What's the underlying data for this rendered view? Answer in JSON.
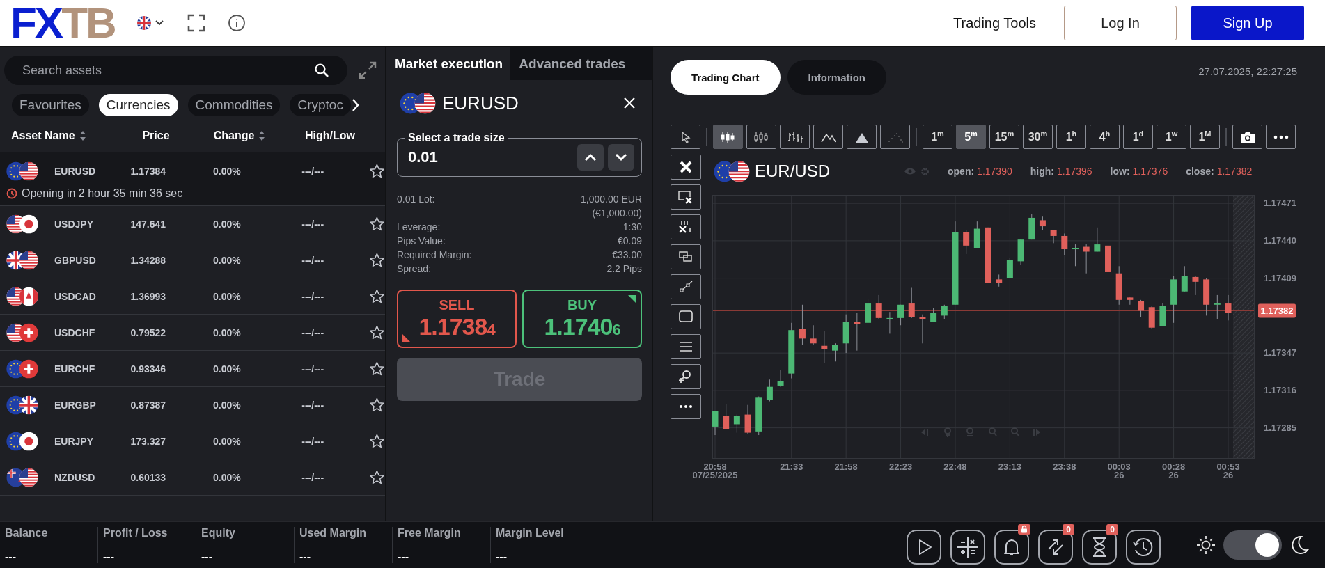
{
  "header": {
    "logo": {
      "primary": "FX",
      "secondary": "TB"
    },
    "nav_link": "Trading Tools",
    "login_button": "Log In",
    "signup_button": "Sign Up"
  },
  "asset_panel": {
    "search": {
      "placeholder": "Search assets"
    },
    "categories": [
      {
        "label": "Favourites",
        "selected": false
      },
      {
        "label": "Currencies",
        "selected": true
      },
      {
        "label": "Commodities",
        "selected": false
      },
      {
        "label": "Cryptoc",
        "selected": false
      }
    ],
    "columns": [
      {
        "label": "Asset Name",
        "sortable": true
      },
      {
        "label": "Price",
        "sortable": false
      },
      {
        "label": "Change",
        "sortable": true
      },
      {
        "label": "High/Low",
        "sortable": false
      }
    ],
    "rows": [
      {
        "symbol": "EURUSD",
        "price": "1.17384",
        "change": "0.00%",
        "high_low": "---/---",
        "favourite": false,
        "selected": true,
        "notice": "Opening in 2 hour 35 min 36 sec"
      },
      {
        "symbol": "USDJPY",
        "price": "147.641",
        "change": "0.00%",
        "high_low": "---/---",
        "favourite": false,
        "selected": false
      },
      {
        "symbol": "GBPUSD",
        "price": "1.34288",
        "change": "0.00%",
        "high_low": "---/---",
        "favourite": false,
        "selected": false
      },
      {
        "symbol": "USDCAD",
        "price": "1.36993",
        "change": "0.00%",
        "high_low": "---/---",
        "favourite": false,
        "selected": false
      },
      {
        "symbol": "USDCHF",
        "price": "0.79522",
        "change": "0.00%",
        "high_low": "---/---",
        "favourite": false,
        "selected": false
      },
      {
        "symbol": "EURCHF",
        "price": "0.93346",
        "change": "0.00%",
        "high_low": "---/---",
        "favourite": false,
        "selected": false
      },
      {
        "symbol": "EURGBP",
        "price": "0.87387",
        "change": "0.00%",
        "high_low": "---/---",
        "favourite": false,
        "selected": false
      },
      {
        "symbol": "EURJPY",
        "price": "173.327",
        "change": "0.00%",
        "high_low": "---/---",
        "favourite": false,
        "selected": false
      },
      {
        "symbol": "NZDUSD",
        "price": "0.60133",
        "change": "0.00%",
        "high_low": "---/---",
        "favourite": false,
        "selected": false
      }
    ]
  },
  "trade_panel": {
    "tabs": [
      {
        "label": "Market execution",
        "selected": true
      },
      {
        "label": "Advanced trades",
        "selected": false
      }
    ],
    "asset": {
      "symbol": "EURUSD"
    },
    "trade_size": {
      "label": "Select a trade size",
      "value": "0.01"
    },
    "details": [
      {
        "label": "0.01 Lot:",
        "values": [
          "1,000.00 EUR",
          "(€1,000.00)"
        ]
      },
      {
        "label": "Leverage:",
        "values": [
          "1:30"
        ]
      },
      {
        "label": "Pips Value:",
        "values": [
          "€0.09"
        ]
      },
      {
        "label": "Required Margin:",
        "values": [
          "€33.00"
        ]
      },
      {
        "label": "Spread:",
        "values": [
          "2.2 Pips"
        ]
      }
    ],
    "quotes": [
      {
        "kind": "sell",
        "label": "SELL",
        "price": "1.1738",
        "pip": "4"
      },
      {
        "kind": "buy",
        "label": "BUY",
        "price": "1.1740",
        "pip": "6"
      }
    ],
    "trade_button": {
      "label": "Trade",
      "disabled": true
    }
  },
  "chart_panel": {
    "tabs": [
      {
        "label": "Trading Chart",
        "selected": true
      },
      {
        "label": "Information",
        "selected": false
      }
    ],
    "datetime": "27.07.2025, 22:27:25",
    "chart_types": [
      {
        "kind": "candles",
        "selected": true
      },
      {
        "kind": "hollow",
        "selected": false
      },
      {
        "kind": "bars",
        "selected": false
      },
      {
        "kind": "line",
        "selected": false
      },
      {
        "kind": "area",
        "selected": false
      },
      {
        "kind": "dots",
        "selected": false
      }
    ],
    "timeframes": [
      {
        "label": "1$^{m}$",
        "selected": false
      },
      {
        "label": "5$^{m}$",
        "selected": true
      },
      {
        "label": "15$^{m}$",
        "selected": false
      },
      {
        "label": "30$^{m}$",
        "selected": false
      },
      {
        "label": "1$^{h}$",
        "selected": false
      },
      {
        "label": "4$^{h}$",
        "selected": false
      },
      {
        "label": "1$^{d}$",
        "selected": false
      },
      {
        "label": "1$^{w}$",
        "selected": false
      },
      {
        "label": "1$^{M}$",
        "selected": false
      }
    ],
    "instrument": {
      "name": "EUR/USD"
    },
    "ohlc": [
      {
        "label": "open:",
        "value": "1.17390"
      },
      {
        "label": "high:",
        "value": "1.17396"
      },
      {
        "label": "low:",
        "value": "1.17376"
      },
      {
        "label": "close:",
        "value": "1.17382"
      }
    ],
    "chart_data": {
      "type": "candlestick",
      "grid": true,
      "ylim": [
        1.1726,
        1.17478
      ],
      "yticks": [
        {
          "value": 1.17471,
          "label": "1.17471"
        },
        {
          "value": 1.1744,
          "label": "1.17440"
        },
        {
          "value": 1.17409,
          "label": "1.17409"
        },
        {
          "value": 1.17347,
          "label": "1.17347"
        },
        {
          "value": 1.17316,
          "label": "1.17316"
        },
        {
          "value": 1.17285,
          "label": "1.17285"
        }
      ],
      "ref_lines": [
        {
          "axis": "y",
          "value": 1.17382,
          "label": "1.17382"
        }
      ],
      "categories": [
        "20:58\n07/25/2025",
        null,
        null,
        null,
        null,
        null,
        null,
        "21:33",
        null,
        null,
        null,
        null,
        "21:58",
        null,
        null,
        null,
        null,
        "22:23",
        null,
        null,
        null,
        null,
        "22:48",
        null,
        null,
        null,
        null,
        "23:13",
        null,
        null,
        null,
        null,
        "23:38",
        null,
        null,
        null,
        null,
        "00:03\n26",
        null,
        null,
        null,
        null,
        "00:28\n26",
        null,
        null,
        null,
        null,
        "00:53\n26"
      ],
      "ohlc": [
        [
          1.17286,
          1.17299,
          1.17279,
          1.17299
        ],
        [
          1.17295,
          1.17305,
          1.17284,
          1.17284
        ],
        [
          1.17288,
          1.17296,
          1.17281,
          1.17295
        ],
        [
          1.17296,
          1.17304,
          1.1728,
          1.17281
        ],
        [
          1.17282,
          1.17311,
          1.17279,
          1.1731
        ],
        [
          1.17308,
          1.17325,
          1.17307,
          1.17319
        ],
        [
          1.1732,
          1.17333,
          1.17319,
          1.17324
        ],
        [
          1.1733,
          1.17372,
          1.17326,
          1.17366
        ],
        [
          1.17367,
          1.17387,
          1.17354,
          1.17359
        ],
        [
          1.17359,
          1.1737,
          1.17354,
          1.17355
        ],
        [
          1.17353,
          1.17365,
          1.17339,
          1.1735
        ],
        [
          1.17349,
          1.17355,
          1.1734,
          1.17354
        ],
        [
          1.17355,
          1.17379,
          1.17347,
          1.17373
        ],
        [
          1.17373,
          1.1738,
          1.17349,
          1.17371
        ],
        [
          1.17372,
          1.17392,
          1.17372,
          1.17388
        ],
        [
          1.17388,
          1.17395,
          1.17375,
          1.17376
        ],
        [
          1.17375,
          1.17381,
          1.17363,
          1.17376
        ],
        [
          1.17376,
          1.17387,
          1.1737,
          1.17387
        ],
        [
          1.17388,
          1.17401,
          1.17376,
          1.17377
        ],
        [
          1.17377,
          1.17379,
          1.17355,
          1.17375
        ],
        [
          1.17373,
          1.17384,
          1.17373,
          1.1738
        ],
        [
          1.17378,
          1.17387,
          1.17375,
          1.17386
        ],
        [
          1.17387,
          1.17456,
          1.17387,
          1.17447
        ],
        [
          1.17447,
          1.17449,
          1.17429,
          1.17436
        ],
        [
          1.17434,
          1.17456,
          1.17434,
          1.1745
        ],
        [
          1.17451,
          1.17451,
          1.17405,
          1.17405
        ],
        [
          1.17408,
          1.17412,
          1.17402,
          1.17405
        ],
        [
          1.17409,
          1.17426,
          1.17409,
          1.17424
        ],
        [
          1.17423,
          1.17441,
          1.1742,
          1.17441
        ],
        [
          1.17441,
          1.17462,
          1.17441,
          1.17459
        ],
        [
          1.17457,
          1.1746,
          1.17449,
          1.17452
        ],
        [
          1.17449,
          1.17449,
          1.17438,
          1.17444
        ],
        [
          1.17444,
          1.17446,
          1.17428,
          1.17433
        ],
        [
          1.17433,
          1.17437,
          1.17419,
          1.17434
        ],
        [
          1.17435,
          1.17437,
          1.17413,
          1.17431
        ],
        [
          1.17431,
          1.17451,
          1.17431,
          1.17437
        ],
        [
          1.17436,
          1.17438,
          1.17403,
          1.17414
        ],
        [
          1.17413,
          1.17419,
          1.17387,
          1.17391
        ],
        [
          1.17393,
          1.17393,
          1.17387,
          1.17391
        ],
        [
          1.1739,
          1.17391,
          1.17377,
          1.17382
        ],
        [
          1.17385,
          1.17386,
          1.17367,
          1.17368
        ],
        [
          1.17369,
          1.17388,
          1.17369,
          1.17386
        ],
        [
          1.17387,
          1.17411,
          1.17372,
          1.17408
        ],
        [
          1.17398,
          1.17419,
          1.17398,
          1.17411
        ],
        [
          1.1741,
          1.17411,
          1.17395,
          1.17406
        ],
        [
          1.17408,
          1.17409,
          1.17378,
          1.17387
        ],
        [
          1.17387,
          1.17395,
          1.17375,
          1.17388
        ],
        [
          1.17388,
          1.17395,
          1.17374,
          1.1738
        ]
      ]
    }
  },
  "footer": {
    "stats": [
      {
        "label": "Balance",
        "value": "---"
      },
      {
        "label": "Profit / Loss",
        "value": "---"
      },
      {
        "label": "Equity",
        "value": "---"
      },
      {
        "label": "Used Margin",
        "value": "---"
      },
      {
        "label": "Free Margin",
        "value": "---"
      },
      {
        "label": "Margin Level",
        "value": "---"
      }
    ],
    "tools": [
      {
        "kind": "play"
      },
      {
        "kind": "calculator"
      },
      {
        "kind": "alerts",
        "locked": true
      },
      {
        "kind": "positions",
        "badge": "0"
      },
      {
        "kind": "orders",
        "badge": "0"
      },
      {
        "kind": "history"
      }
    ],
    "dark_mode": {
      "on": true
    }
  }
}
